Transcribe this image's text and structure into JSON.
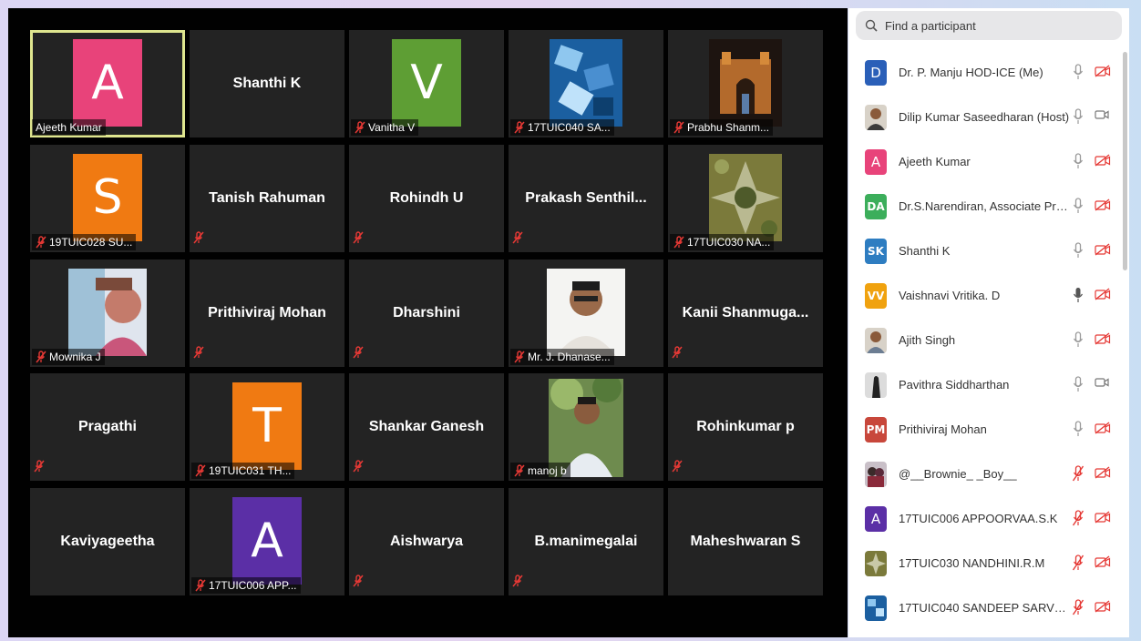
{
  "gallery": {
    "tiles": [
      {
        "kind": "avatar",
        "letter": "A",
        "color": "#e8437a",
        "label": "Ajeeth Kumar",
        "muted": false,
        "active": true
      },
      {
        "kind": "name",
        "name": "Shanthi K"
      },
      {
        "kind": "avatar",
        "letter": "V",
        "color": "#5e9e34",
        "label": "Vanitha V",
        "muted": true
      },
      {
        "kind": "photo",
        "photo": "cubes",
        "label": "17TUIC040 SA...",
        "muted": true
      },
      {
        "kind": "photo",
        "photo": "monument",
        "label": "Prabhu Shanm...",
        "muted": true
      },
      {
        "kind": "avatar",
        "letter": "S",
        "color": "#f07a12",
        "label": "19TUIC028 SU...",
        "muted": true
      },
      {
        "kind": "name",
        "name": "Tanish Rahuman",
        "muted": true
      },
      {
        "kind": "name",
        "name": "Rohindh U",
        "muted": true
      },
      {
        "kind": "name",
        "name": "Prakash  Senthil...",
        "muted": true
      },
      {
        "kind": "photo",
        "photo": "pattern",
        "label": "17TUIC030 NA...",
        "muted": true
      },
      {
        "kind": "photo",
        "photo": "girl",
        "label": "Mownika J",
        "muted": true
      },
      {
        "kind": "name",
        "name": "Prithiviraj Mohan",
        "muted": true
      },
      {
        "kind": "name",
        "name": "Dharshini",
        "muted": true
      },
      {
        "kind": "photo",
        "photo": "man",
        "label": "Mr. J. Dhanase...",
        "muted": true
      },
      {
        "kind": "name",
        "name": "Kanii  Shanmuga...",
        "muted": true
      },
      {
        "kind": "name",
        "name": "Pragathi",
        "muted": true
      },
      {
        "kind": "avatar",
        "letter": "T",
        "color": "#f07a12",
        "label": "19TUIC031 TH...",
        "muted": true
      },
      {
        "kind": "name",
        "name": "Shankar Ganesh",
        "muted": true
      },
      {
        "kind": "photo",
        "photo": "outdoor",
        "label": "manoj b",
        "muted": true
      },
      {
        "kind": "name",
        "name": "Rohinkumar p",
        "muted": true
      },
      {
        "kind": "name",
        "name": "Kaviyageetha"
      },
      {
        "kind": "avatar",
        "letter": "A",
        "color": "#5b2fa6",
        "label": "17TUIC006 APP...",
        "muted": true
      },
      {
        "kind": "name",
        "name": "Aishwarya",
        "muted": true
      },
      {
        "kind": "name",
        "name": "B.manimegalai",
        "muted": true
      },
      {
        "kind": "name",
        "name": "Maheshwaran S"
      }
    ]
  },
  "panel": {
    "search_placeholder": "Find a participant",
    "participants": [
      {
        "avatar": "D",
        "avatar_color": "#2a5fb8",
        "name": "Dr. P. Manju HOD-ICE (Me)",
        "mic": "off",
        "cam": "off"
      },
      {
        "avatar": "photo-man1",
        "avatar_color": "#6b5a46",
        "name": "Dilip Kumar Saseedharan (Host)",
        "mic": "off",
        "cam": "on"
      },
      {
        "avatar": "A",
        "avatar_color": "#e8437a",
        "name": "Ajeeth Kumar",
        "mic": "off",
        "cam": "off"
      },
      {
        "avatar": "DA",
        "avatar_color": "#3cae5b",
        "name": "Dr.S.Narendiran, Associate Prof...",
        "mic": "off",
        "cam": "off"
      },
      {
        "avatar": "SK",
        "avatar_color": "#2e7dc1",
        "name": "Shanthi K",
        "mic": "off",
        "cam": "off"
      },
      {
        "avatar": "VV",
        "avatar_color": "#f0a20f",
        "name": "Vaishnavi Vritika. D",
        "mic": "on",
        "cam": "off"
      },
      {
        "avatar": "photo-man2",
        "avatar_color": "#8a7a6a",
        "name": "Ajith Singh",
        "mic": "off",
        "cam": "off"
      },
      {
        "avatar": "photo-figure",
        "avatar_color": "#555555",
        "name": "Pavithra Siddharthan",
        "mic": "off",
        "cam": "on"
      },
      {
        "avatar": "PM",
        "avatar_color": "#c8473b",
        "name": "Prithiviraj Mohan",
        "mic": "off",
        "cam": "off"
      },
      {
        "avatar": "photo-couple",
        "avatar_color": "#7a6a6a",
        "name": "@__Brownie_ _Boy__",
        "mic": "muted",
        "cam": "off"
      },
      {
        "avatar": "A",
        "avatar_color": "#5b2fa6",
        "name": "17TUIC006 APPOORVAA.S.K",
        "mic": "muted",
        "cam": "off"
      },
      {
        "avatar": "photo-pattern",
        "avatar_color": "#8a7a3a",
        "name": "17TUIC030 NANDHINI.R.M",
        "mic": "muted",
        "cam": "off"
      },
      {
        "avatar": "photo-cubes",
        "avatar_color": "#3c7bb8",
        "name": "17TUIC040 SANDEEP SARVESH S",
        "mic": "muted",
        "cam": "off"
      }
    ]
  },
  "colors": {
    "muted": "#e53935",
    "tile_bg": "#232323",
    "active_border": "#dfe68f"
  },
  "icons": {
    "search": "search-icon",
    "mic": "microphone-icon",
    "mic_muted": "microphone-muted-icon",
    "cam": "video-camera-icon",
    "cam_off": "video-off-icon"
  }
}
